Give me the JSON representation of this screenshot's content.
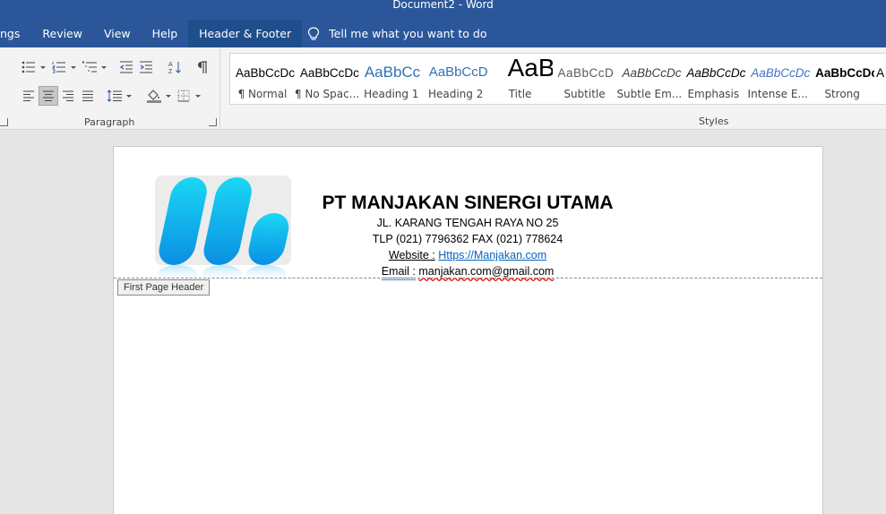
{
  "window": {
    "title": "Document2  -  Word"
  },
  "tabs": [
    "ngs",
    "Review",
    "View",
    "Help",
    "Header & Footer"
  ],
  "tell_me": "Tell me what you want to do",
  "ribbon": {
    "paragraph_label": "Paragraph",
    "styles_label": "Styles",
    "styles": [
      {
        "sample": "AaBbCcDc",
        "name": "¶ Normal"
      },
      {
        "sample": "AaBbCcDc",
        "name": "¶ No Spac..."
      },
      {
        "sample": "AaBbCc",
        "name": "Heading 1"
      },
      {
        "sample": "AaBbCcD",
        "name": "Heading 2"
      },
      {
        "sample": "AaB",
        "name": "Title"
      },
      {
        "sample": "AaBbCcD",
        "name": "Subtitle"
      },
      {
        "sample": "AaBbCcDc",
        "name": "Subtle Em..."
      },
      {
        "sample": "AaBbCcDc",
        "name": "Emphasis"
      },
      {
        "sample": "AaBbCcDc",
        "name": "Intense E..."
      },
      {
        "sample": "AaBbCcDc",
        "name": "Strong"
      },
      {
        "sample": "A",
        "name": ""
      }
    ]
  },
  "document": {
    "company": "PT MANJAKAN SINERGI UTAMA",
    "address": "JL. KARANG TENGAH RAYA NO 25",
    "phone": "TLP (021) 7796362 FAX (021) 778624",
    "website_label": "Website :",
    "website_url": "Https://Manjakan.com",
    "email_label": "Email :",
    "email_value": "manjakan.com@gmail.com",
    "header_tag": "First Page Header"
  },
  "colors": {
    "accent": "#2b579a",
    "active_tab": "#1f4e8c",
    "link": "#0563c1",
    "logo_cyan": "#1ad7f5",
    "logo_blue": "#0a8fe3"
  }
}
